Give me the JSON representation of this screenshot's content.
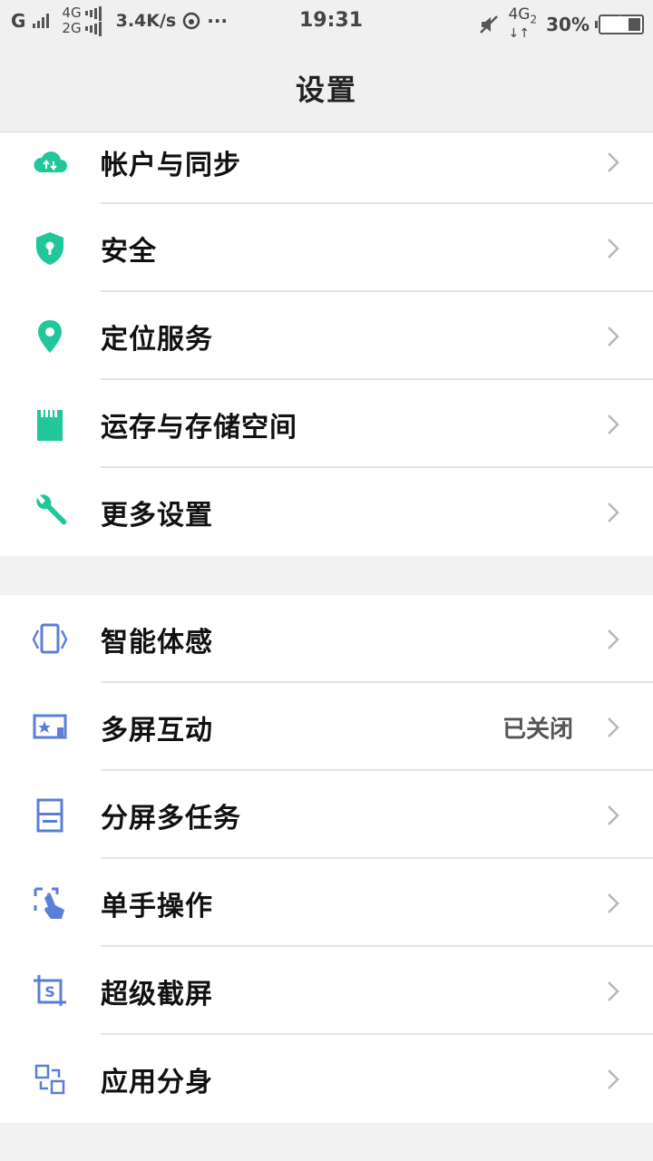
{
  "status_bar": {
    "sim1_type": "G",
    "net_4g": "4G",
    "net_2g": "2G",
    "speed": "3.4K/s",
    "more": "···",
    "time": "19:31",
    "data_type": "4G",
    "data_slot": "2",
    "battery_text": "30%",
    "battery_level": 0.3
  },
  "header": {
    "title": "设置"
  },
  "groups": [
    {
      "items": [
        {
          "label": "帐户与同步",
          "icon": "cloud-sync-icon"
        },
        {
          "label": "安全",
          "icon": "shield-icon"
        },
        {
          "label": "定位服务",
          "icon": "location-pin-icon"
        },
        {
          "label": "运存与存储空间",
          "icon": "sd-card-icon"
        },
        {
          "label": "更多设置",
          "icon": "wrench-icon"
        }
      ]
    },
    {
      "items": [
        {
          "label": "智能体感",
          "icon": "phone-motion-icon"
        },
        {
          "label": "多屏互动",
          "icon": "cast-screen-icon",
          "value": "已关闭"
        },
        {
          "label": "分屏多任务",
          "icon": "split-screen-icon"
        },
        {
          "label": "单手操作",
          "icon": "one-hand-icon"
        },
        {
          "label": "超级截屏",
          "icon": "screenshot-icon"
        },
        {
          "label": "应用分身",
          "icon": "app-clone-icon"
        }
      ]
    }
  ],
  "colors": {
    "teal": "#1fc79a",
    "blue": "#5b7fd6",
    "chevron": "#b8b8b8"
  }
}
